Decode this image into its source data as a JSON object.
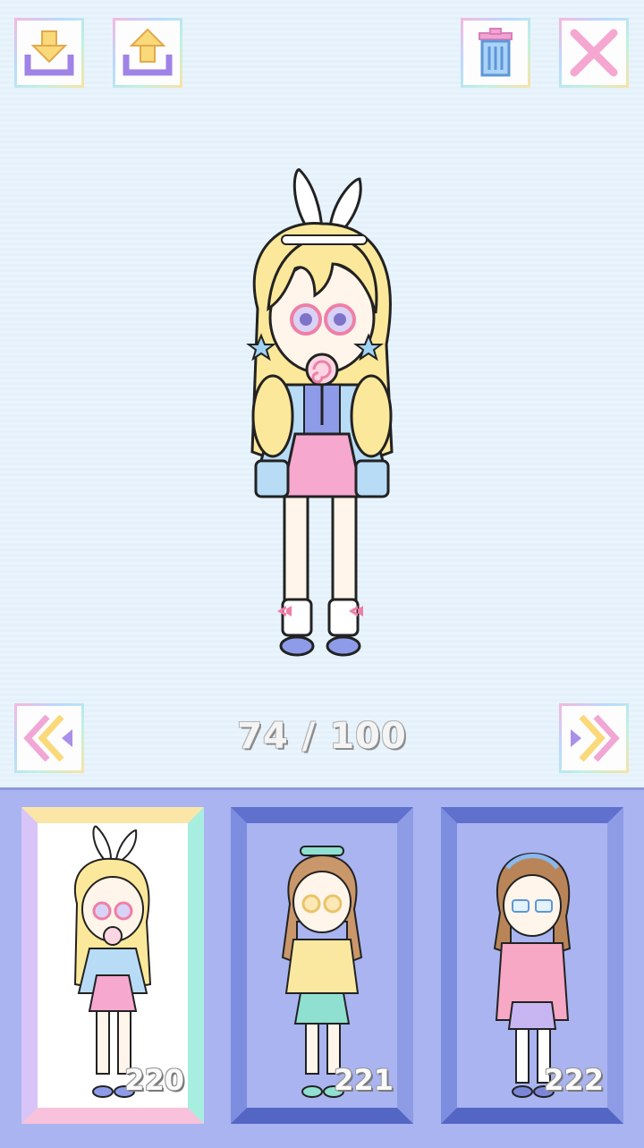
{
  "toolbar": {
    "download": {
      "icon": "download-icon"
    },
    "upload": {
      "icon": "upload-icon"
    },
    "delete": {
      "icon": "trash-icon"
    },
    "close": {
      "icon": "close-icon"
    }
  },
  "navigation": {
    "prev_icon": "double-chevron-left-icon",
    "next_icon": "double-chevron-right-icon",
    "counter": "74 / 100"
  },
  "slots": [
    {
      "number": "220",
      "selected": true
    },
    {
      "number": "221",
      "selected": false
    },
    {
      "number": "222",
      "selected": false
    }
  ],
  "colors": {
    "background": "#e6f2fb",
    "tray": "#a9b4f0",
    "accent_yellow": "#f9d97a",
    "accent_purple": "#9f83e6",
    "accent_pink": "#f2a3d3",
    "accent_blue": "#8ab8f0"
  }
}
